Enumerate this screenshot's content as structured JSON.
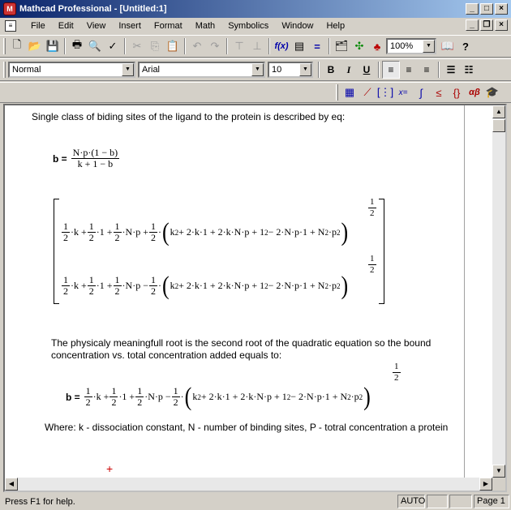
{
  "window": {
    "title": "Mathcad Professional - [Untitled:1]"
  },
  "menu": [
    "File",
    "Edit",
    "View",
    "Insert",
    "Format",
    "Math",
    "Symbolics",
    "Window",
    "Help"
  ],
  "toolbar": {
    "zoom": "100%"
  },
  "format_bar": {
    "style": "Normal",
    "font": "Arial",
    "size": "10",
    "bold": "B",
    "italic": "I",
    "underline": "U"
  },
  "document": {
    "intro": "Single class of biding sites of the ligand to the protein is described by eq:",
    "eq1": {
      "lhs": "b =",
      "num": "N·p·(1 − b)",
      "den": "k + 1 − b"
    },
    "root_plus": "·k + ",
    "paragraph2": "The physicaly meaningfull root is the second root of the quadratic equation so the bound concentration vs. total concentration added equals to:",
    "eq3_lhs": "b =",
    "where": "Where: k - dissociation constant, N - number of binding sites, P - totral concentration a protein"
  },
  "math_parts": {
    "half_num": "1",
    "half_den": "2",
    "k": "·k + ",
    "one": "·1 + ",
    "np": "·N·p + ",
    "np_minus": "·N·p − ",
    "open": "(",
    "close": ")",
    "k2": "k",
    "two": "2",
    "mid": " + 2·k·1 + 2·k·N·p + 1",
    "tail": " − 2·N·p·1 + N",
    "p2": "·p",
    "dot": "·"
  },
  "status": {
    "help": "Press F1 for help.",
    "mode": "AUTO",
    "page": "Page 1"
  }
}
